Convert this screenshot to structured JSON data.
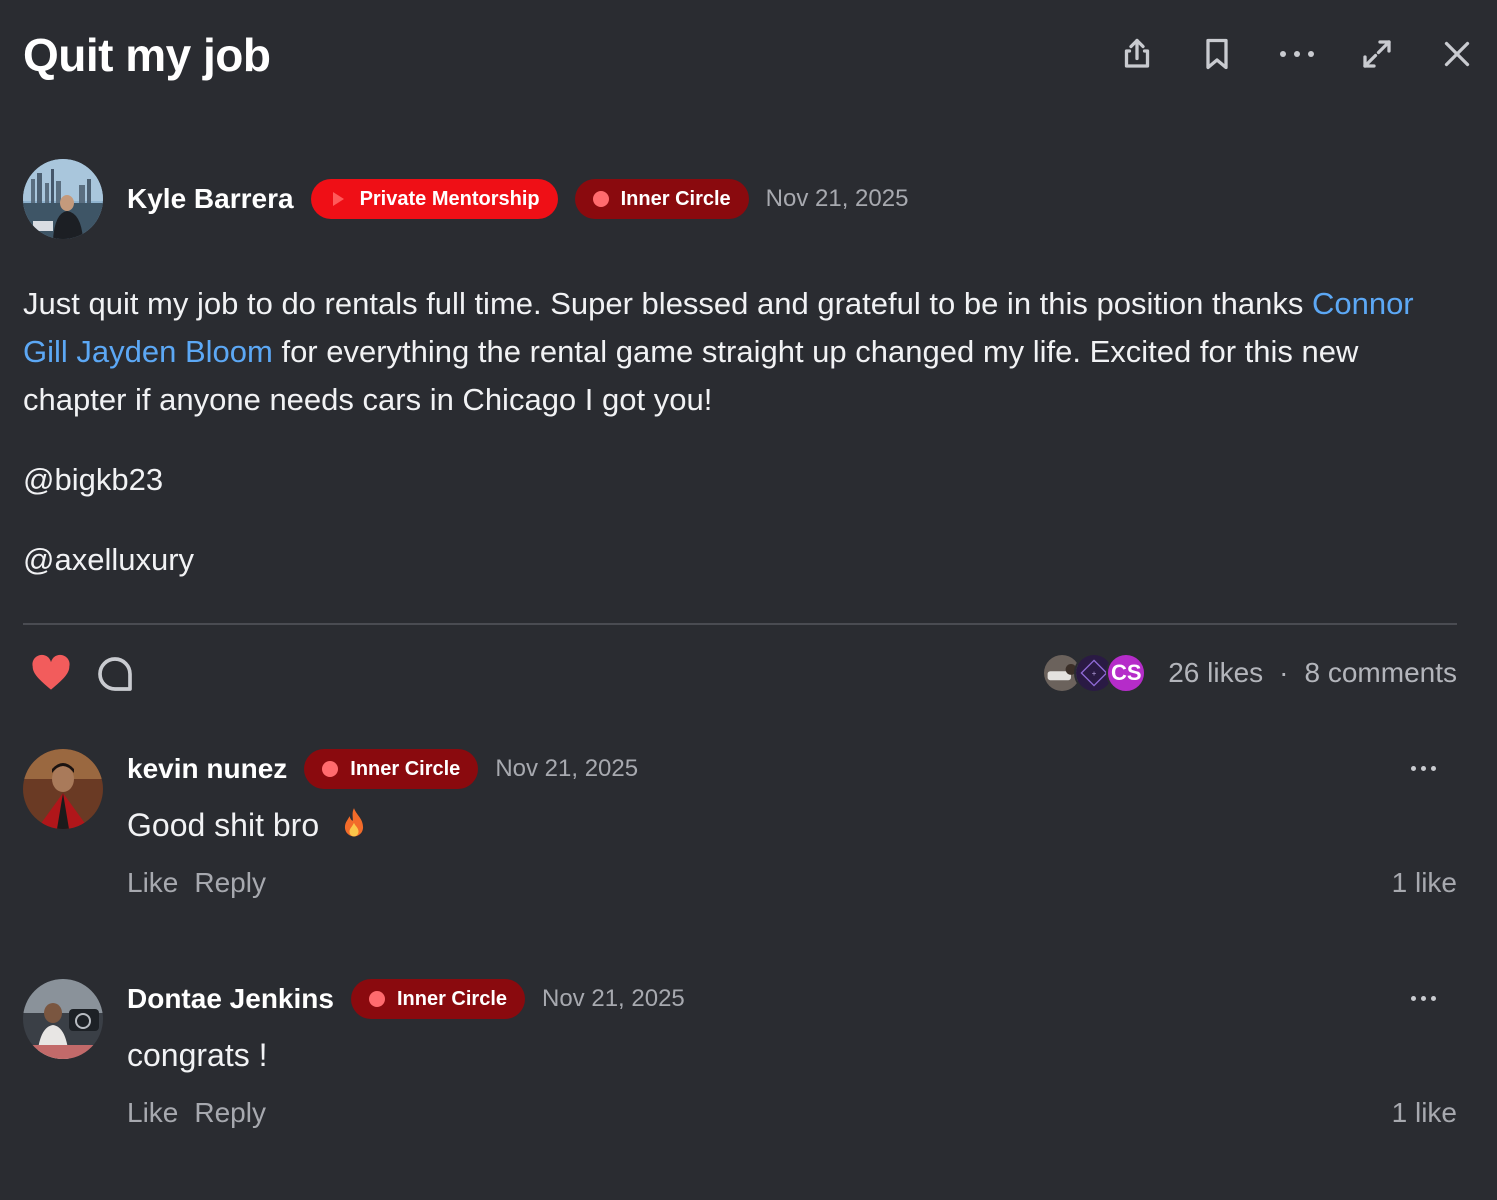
{
  "post": {
    "title": "Quit my job",
    "author": {
      "name": "Kyle Barrera",
      "badges": [
        "Private Mentorship",
        "Inner Circle"
      ],
      "date": "Nov 21, 2025"
    },
    "body": {
      "line_start": "Just quit my job to do rentals full time. Super blessed and grateful to be in this position thanks",
      "mentions": "Connor Gill Jayden Bloom",
      "line_rest": " for everything the rental game straight up changed my life. Excited for this new chapter if anyone needs cars in Chicago I got you!",
      "handle1": "@bigkb23",
      "handle2": "@axelluxury"
    },
    "stats": {
      "likes": "26 likes",
      "separator": "·",
      "comments": "8 comments",
      "liker_initials": "CS"
    }
  },
  "header_icons": [
    "share-icon",
    "bookmark-icon",
    "more-icon",
    "expand-icon",
    "close-icon"
  ],
  "comments": [
    {
      "name": "kevin nunez",
      "badge": "Inner Circle",
      "date": "Nov 21, 2025",
      "text": "Good shit bro",
      "emoji": "fire",
      "like_label": "Like",
      "reply_label": "Reply",
      "likes": "1 like"
    },
    {
      "name": "Dontae Jenkins",
      "badge": "Inner Circle",
      "date": "Nov 21, 2025",
      "text": "congrats !",
      "like_label": "Like",
      "reply_label": "Reply",
      "likes": "1 like"
    }
  ],
  "colors": {
    "background": "#2a2c31",
    "badge_primary": "#ef0f16",
    "badge_secondary": "#8a0a0e",
    "link": "#5ca8f5",
    "heart": "#f25c5c"
  }
}
